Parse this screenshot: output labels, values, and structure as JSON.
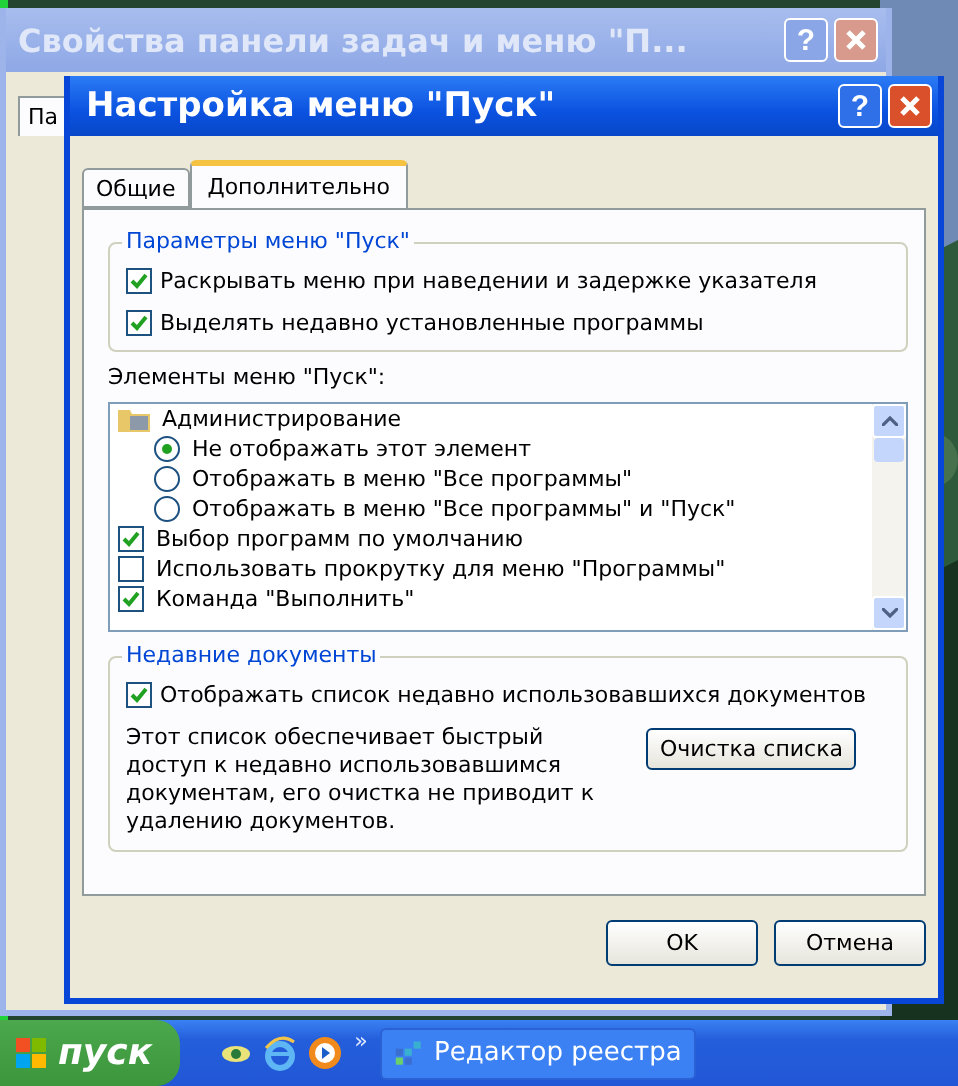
{
  "back_window": {
    "title": "Свойства панели задач и меню \"П...",
    "help": "?",
    "tab": "Па"
  },
  "dialog": {
    "title": "Настройка меню \"Пуск\"",
    "help": "?",
    "tabs": [
      {
        "label": "Общие",
        "selected": false
      },
      {
        "label": "Дополнительно",
        "selected": true
      }
    ],
    "start_menu_settings": {
      "legend": "Параметры меню \"Пуск\"",
      "options": [
        {
          "label": "Раскрывать меню при наведении и задержке указателя",
          "checked": true
        },
        {
          "label": "Выделять недавно установленные программы",
          "checked": true
        }
      ]
    },
    "items_label": "Элементы меню \"Пуск\":",
    "items": [
      {
        "kind": "folder",
        "label": "Администрирование"
      },
      {
        "kind": "radio",
        "label": "Не отображать этот элемент",
        "selected": true
      },
      {
        "kind": "radio",
        "label": "Отображать в меню \"Все программы\"",
        "selected": false
      },
      {
        "kind": "radio",
        "label": "Отображать в меню \"Все программы\" и \"Пуск\"",
        "selected": false
      },
      {
        "kind": "checkbox",
        "label": "Выбор программ по умолчанию",
        "checked": true
      },
      {
        "kind": "checkbox",
        "label": "Использовать прокрутку для меню \"Программы\"",
        "checked": false
      },
      {
        "kind": "checkbox",
        "label": "Команда \"Выполнить\"",
        "checked": true
      }
    ],
    "recent_docs": {
      "legend": "Недавние документы",
      "option": {
        "label": "Отображать список недавно использовавшихся документов",
        "checked": true
      },
      "description": "Этот список обеспечивает быстрый доступ к недавно использовавшимся документам, его очистка не приводит к удалению документов.",
      "clear_button": "Очистка списка"
    },
    "buttons": [
      "OK",
      "Отмена"
    ]
  },
  "taskbar": {
    "start": "пуск",
    "chevron": "»",
    "tasks": [
      {
        "label": "Редактор реестра"
      }
    ]
  }
}
